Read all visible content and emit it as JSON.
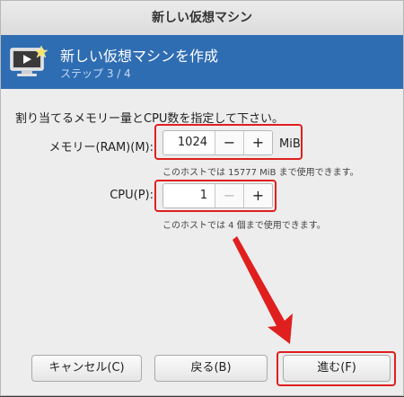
{
  "window": {
    "title": "新しい仮想マシン"
  },
  "header": {
    "title": "新しい仮想マシンを作成",
    "step": "ステップ 3 / 4",
    "icon": "monitor-play-icon"
  },
  "instruction": "割り当てるメモリー量とCPU数を指定して下さい。",
  "memory": {
    "label": "メモリー(RAM)(M):",
    "value": "1024",
    "unit": "MiB",
    "minus": "−",
    "plus": "+",
    "hint": "このホストでは 15777 MiB まで使用できます。"
  },
  "cpu": {
    "label": "CPU(P):",
    "value": "1",
    "minus": "−",
    "plus": "+",
    "hint": "このホストでは 4 個まで使用できます。"
  },
  "buttons": {
    "cancel": "キャンセル(C)",
    "back": "戻る(B)",
    "forward": "進む(F)"
  },
  "colors": {
    "header_bg": "#2f6db3",
    "highlight": "#e01f1f"
  }
}
